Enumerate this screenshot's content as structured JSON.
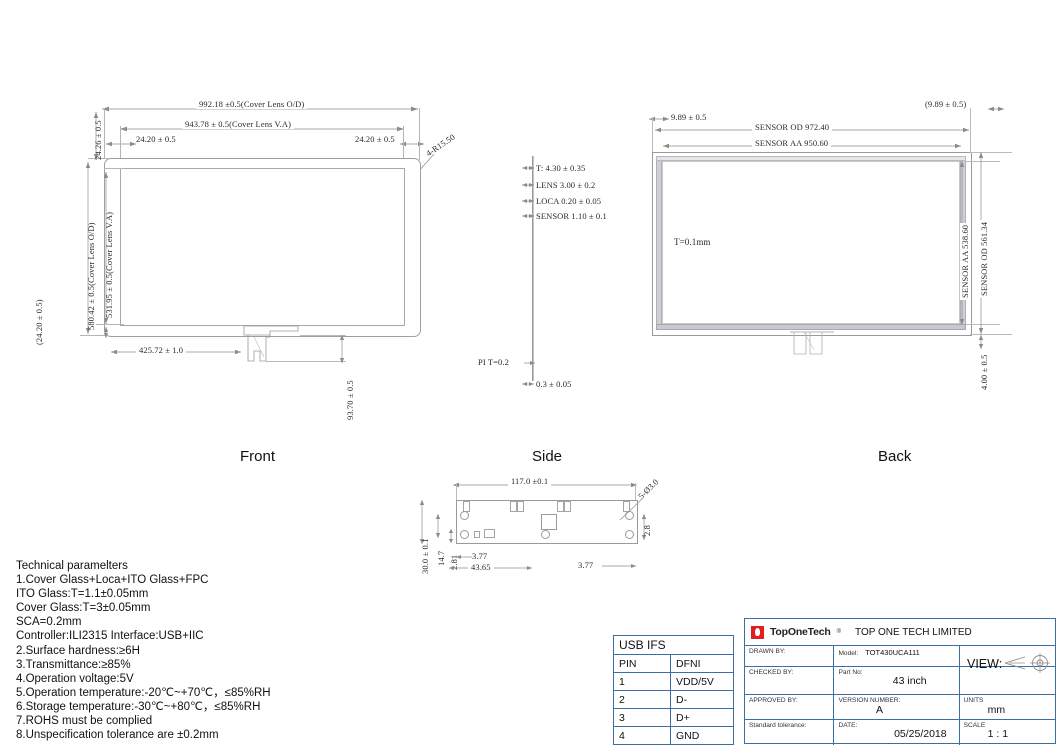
{
  "views": {
    "front_label": "Front",
    "side_label": "Side",
    "back_label": "Back"
  },
  "front": {
    "dim_top_od": "992.18    ±0.5(Cover Lens O/D)",
    "dim_top_va": "943.78 ± 0.5(Cover Lens V.A)",
    "dim_top_left_inset": "24.20 ± 0.5",
    "dim_top_right_inset": "24.20 ± 0.5",
    "radius_note": "4-R15.50",
    "dim_left_top_inset": "24.26 ± 0.5",
    "dim_left_od": "580.42    ± 0.5(Cover Lens O/D)",
    "dim_left_va": "531.95 ± 0.5(Cover Lens V.A)",
    "dim_left_bottom_inset": "(24.20 ± 0.5)",
    "dim_bottom_fpc_offset": "425.72 ± 1.0",
    "dim_fpc_length": "93.70 ± 0.5"
  },
  "side": {
    "total_thickness": "T: 4.30 ± 0.35",
    "lens": "LENS 3.00 ± 0.2",
    "loca": "LOCA 0.20 ± 0.05",
    "sensor": "SENSOR 1.10 ± 0.1",
    "pi": "PI  T=0.2",
    "bottom": "0.3 ± 0.05"
  },
  "back": {
    "dim_left_inset": "9.89 ± 0.5",
    "dim_right_inset": "(9.89 ± 0.5)",
    "sensor_od_h": "SENSOR OD 972.40",
    "sensor_aa_h": "SENSOR AA 950.60",
    "sensor_aa_v": "SENSOR AA 538.60",
    "sensor_od_v": "SENSOR OD 561.34",
    "bottom_inset": "4.00 ± 0.5",
    "thickness_note": "T=0.1mm"
  },
  "pcb": {
    "width": "117.0   ±0.1",
    "height": "30.0 ± 0.1",
    "hole_note": "5-Ø3.0",
    "d1": "14.7",
    "d2": "2.81",
    "d3": "3.77",
    "d4": "43.65",
    "d5": "3.77",
    "d6": "2.8"
  },
  "technical": {
    "title": "Technical paramelters",
    "lines": [
      "1.Cover Glass+Loca+ITO Glass+FPC",
      "   ITO Glass:T=1.1±0.05mm",
      "   Cover Glass:T=3±0.05mm",
      "   SCA=0.2mm",
      "   Controller:ILI2315    Interface:USB+IIC",
      "2.Surface hardness:≥6H",
      "3.Transmittance:≥85%",
      "4.Operation voltage:5V",
      "5.Operation temperature:-20℃~+70℃，≤85%RH",
      "6.Storage temperature:-30℃~+80℃，≤85%RH",
      "7.ROHS must be complied",
      "8.Unspecification tolerance are ±0.2mm"
    ]
  },
  "usb_table": {
    "title": "USB IFS",
    "headers": [
      "PIN",
      "DFNI"
    ],
    "rows": [
      [
        "1",
        "VDD/5V"
      ],
      [
        "2",
        "D-"
      ],
      [
        "3",
        "D+"
      ],
      [
        "4",
        "GND"
      ]
    ]
  },
  "title_block": {
    "brand_short": "TopOneTech",
    "brand_reg": "®",
    "brand_full": "TOP ONE TECH LIMITED",
    "drawn_by_label": "DRAWN BY:",
    "drawn_by_value": "",
    "checked_by_label": "CHECKED BY:",
    "checked_by_value": "",
    "approved_by_label": "APPROVED BY:",
    "approved_by_value": "",
    "standard_tolerance_label": "Standard tolerance:",
    "standard_tolerance_value": "",
    "model_label": "Model:",
    "model_value": "TOT430UCA111",
    "part_no_label": "Part No:",
    "part_no_value": "43 inch",
    "version_label": "VERSION NUMBER:",
    "version_value": "A",
    "date_label": "DATE:",
    "date_value": "05/25/2018",
    "view_label": "VIEW:",
    "units_label": "UNITS",
    "units_value": "mm",
    "scale_label": "SCALE",
    "scale_value": "1 : 1"
  },
  "colors": {
    "line": "#8c8c8c",
    "table_border": "#3a6ea5",
    "logo_red": "#e02020",
    "text": "#111111"
  }
}
